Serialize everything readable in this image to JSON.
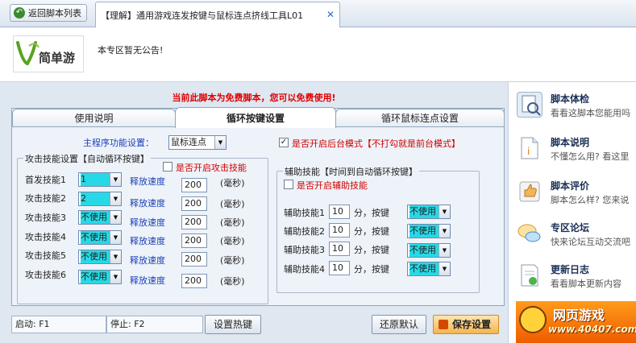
{
  "topbar": {
    "back_label": "返回脚本列表",
    "tab_title": "【理解】通用游戏连发按键与鼠标连点挤线工具L01",
    "tab_close": "✕"
  },
  "notice": {
    "logo_text": "简单游",
    "text": "本专区暂无公告!"
  },
  "free_message": "当前此脚本为免费脚本，您可以免费使用!",
  "tabs": [
    "使用说明",
    "循环按键设置",
    "循环鼠标连点设置"
  ],
  "loop": {
    "main_func_label": "主程序功能设置：",
    "main_func_value": "鼠标连点",
    "background_mode_label": "是否开启后台模式【不打勾就是前台模式】",
    "attack_group_title": "攻击技能设置【自动循环按键】",
    "attack_enable_label": "是否开启攻击技能",
    "release_label": "释放速度",
    "ms_label": "(毫秒)",
    "skills": [
      {
        "label": "首发技能1",
        "key": "1",
        "speed": "200"
      },
      {
        "label": "攻击技能2",
        "key": "2",
        "speed": "200"
      },
      {
        "label": "攻击技能3",
        "key": "不使用",
        "speed": "200"
      },
      {
        "label": "攻击技能4",
        "key": "不使用",
        "speed": "200"
      },
      {
        "label": "攻击技能5",
        "key": "不使用",
        "speed": "200"
      },
      {
        "label": "攻击技能6",
        "key": "不使用",
        "speed": "200"
      }
    ],
    "aux_group_title": "辅助技能【时间到自动循环按键】",
    "aux_enable_label": "是否开启辅助技能",
    "aux_unit": "分，按键",
    "aux_skills": [
      {
        "label": "辅助技能1",
        "minutes": "10",
        "key": "不使用"
      },
      {
        "label": "辅助技能2",
        "minutes": "10",
        "key": "不使用"
      },
      {
        "label": "辅助技能3",
        "minutes": "10",
        "key": "不使用"
      },
      {
        "label": "辅助技能4",
        "minutes": "10",
        "key": "不使用"
      }
    ]
  },
  "bottom": {
    "start_label": "启动: F1",
    "stop_label": "停止: F2",
    "hotkey_btn": "设置热键",
    "restore_btn": "还原默认",
    "save_btn": "保存设置"
  },
  "sidebar": [
    {
      "title": "脚本体检",
      "desc": "看看这脚本您能用吗",
      "icon": "checkup-icon"
    },
    {
      "title": "脚本说明",
      "desc": "不懂怎么用? 看这里",
      "icon": "document-icon"
    },
    {
      "title": "脚本评价",
      "desc": "脚本怎么样? 您来说",
      "icon": "thumb-up-icon"
    },
    {
      "title": "专区论坛",
      "desc": "快来论坛互动交流吧",
      "icon": "chat-bubbles-icon"
    },
    {
      "title": "更新日志",
      "desc": "看看脚本更新内容",
      "icon": "update-log-icon"
    }
  ],
  "ad": {
    "line1": "网页游戏",
    "line2": "www.40407.com"
  },
  "colors": {
    "accent_red": "#e00000",
    "select_cyan": "#27d9e6",
    "label_blue": "#1a3fb8"
  }
}
